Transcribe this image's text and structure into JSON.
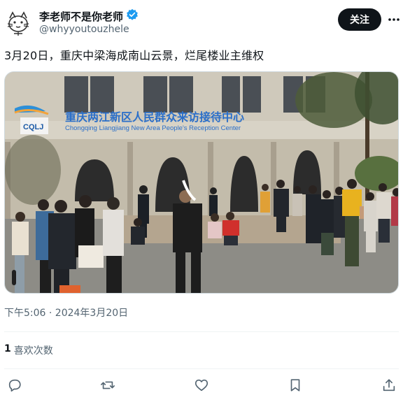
{
  "author": {
    "display_name": "李老师不是你老师",
    "handle": "@whyyoutouzhele",
    "verified": true,
    "follow_label": "关注"
  },
  "tweet": {
    "text": "3月20日，重庆中梁海成南山云景，烂尾楼业主维权",
    "timestamp": "下午5:06 · 2024年3月20日"
  },
  "media": {
    "sign_logo": "CQLJ",
    "sign_chinese": "重庆两江新区人民群众来访接待中心",
    "sign_english": "Chongqing Liangjiang New Area People's Reception Center"
  },
  "stats": {
    "likes_count": "1",
    "likes_label": "喜欢次数"
  },
  "colors": {
    "verified_blue": "#1d9bf0",
    "text_primary": "#0f1419",
    "text_secondary": "#536471"
  },
  "icons": {
    "reply": "reply-icon",
    "retweet": "retweet-icon",
    "like": "heart-icon",
    "bookmark": "bookmark-icon",
    "share": "share-icon"
  }
}
